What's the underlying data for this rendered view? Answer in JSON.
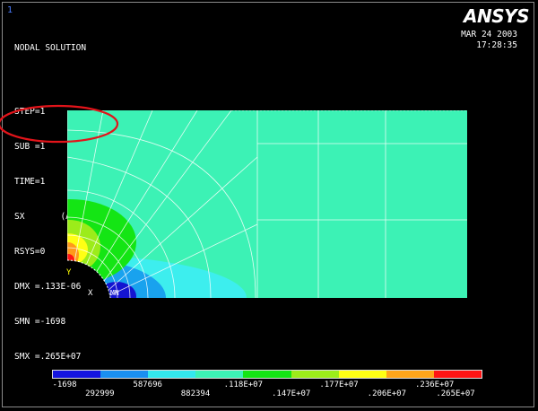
{
  "window_number": "1",
  "info": {
    "title": "NODAL SOLUTION",
    "step": "STEP=1",
    "sub": "SUB =1",
    "time": "TIME=1",
    "component": "SX       (AVG)",
    "rsys": "RSYS=0",
    "dmx": "DMX =.133E-06",
    "smn": "SMN =-1698",
    "smx": "SMX =.265E+07"
  },
  "logo": "ANSYS",
  "timestamp": {
    "date": "MAR 24 2003",
    "time": "17:28:35"
  },
  "triad": {
    "x": "X",
    "y": "Y",
    "mn": "MN"
  },
  "legend": {
    "colors": [
      "#1414e0",
      "#1a8ff0",
      "#33e8ee",
      "#3cf2b5",
      "#14e514",
      "#9cec1a",
      "#ffff14",
      "#ffa51a",
      "#ff1414"
    ],
    "labels": [
      "-1698",
      "292999",
      "587696",
      "882394",
      ".118E+07",
      ".147E+07",
      ".177E+07",
      ".206E+07",
      ".236E+07",
      ".265E+07"
    ]
  }
}
